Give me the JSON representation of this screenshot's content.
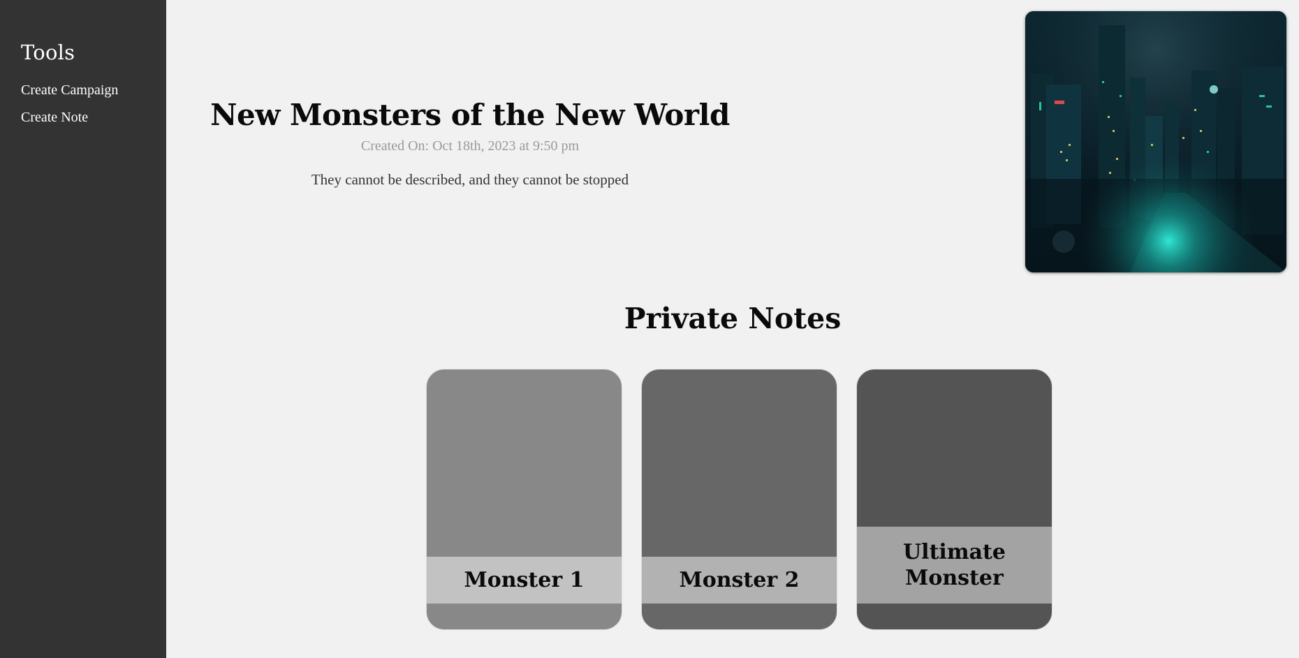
{
  "sidebar": {
    "heading": "Tools",
    "items": [
      {
        "label": "Create Campaign"
      },
      {
        "label": "Create Note"
      }
    ]
  },
  "campaign": {
    "title": "New Monsters of the New World",
    "created": "Created On: Oct 18th, 2023 at 9:50 pm",
    "description": "They cannot be described, and they cannot be stopped",
    "image_alt": "dark futuristic city at night with teal lights"
  },
  "notes_section": {
    "title": "Private Notes",
    "notes": [
      {
        "label": "Monster 1",
        "card_color": "#888888",
        "label_bg": "#c2c2c2"
      },
      {
        "label": "Monster 2",
        "card_color": "#676767",
        "label_bg": "#b2b2b2"
      },
      {
        "label": "Ultimate Monster",
        "card_color": "#545454",
        "label_bg": "#a3a3a3"
      }
    ]
  },
  "colors": {
    "sidebar_bg": "#333333",
    "page_bg": "#f1f1f1",
    "accent_teal": "#1fd6c6"
  }
}
